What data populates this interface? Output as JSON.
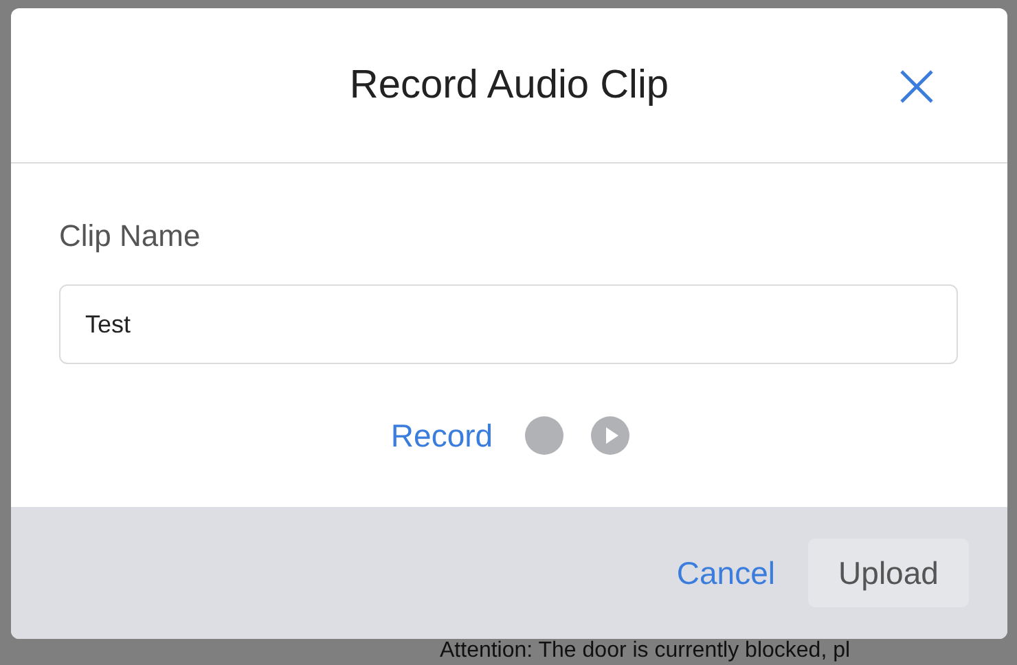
{
  "dialog": {
    "title": "Record Audio Clip",
    "field": {
      "label": "Clip Name",
      "value": "Test"
    },
    "recorder": {
      "label": "Record"
    },
    "buttons": [
      {
        "label": "Cancel",
        "kind": "link"
      },
      {
        "label": "Upload",
        "kind": "button"
      }
    ]
  },
  "background_text": "Attention: The door is currently blocked, pl"
}
